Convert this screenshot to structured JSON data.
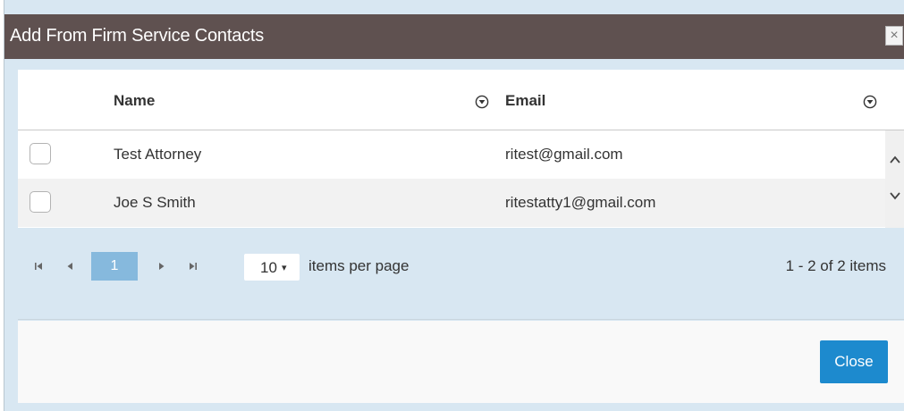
{
  "dialog": {
    "title": "Add From Firm Service Contacts",
    "close_glyph": "×"
  },
  "grid": {
    "columns": [
      {
        "label": "Name",
        "filter_icon": "filter-icon"
      },
      {
        "label": "Email",
        "filter_icon": "filter-icon"
      }
    ],
    "rows": [
      {
        "name": "Test Attorney",
        "email": "ritest@gmail.com",
        "checked": false
      },
      {
        "name": "Joe S Smith",
        "email": "ritestatty1@gmail.com",
        "checked": false
      }
    ]
  },
  "pager": {
    "current_page": "1",
    "page_size": "10",
    "page_size_caret": "▾",
    "page_size_label": "items per page",
    "info": "1 - 2 of 2 items"
  },
  "footer": {
    "close_label": "Close"
  },
  "colors": {
    "titlebar": "#5f5150",
    "accent": "#1d8ace",
    "pager_bg": "#d8e7f2",
    "active_page": "#86b9dd"
  }
}
